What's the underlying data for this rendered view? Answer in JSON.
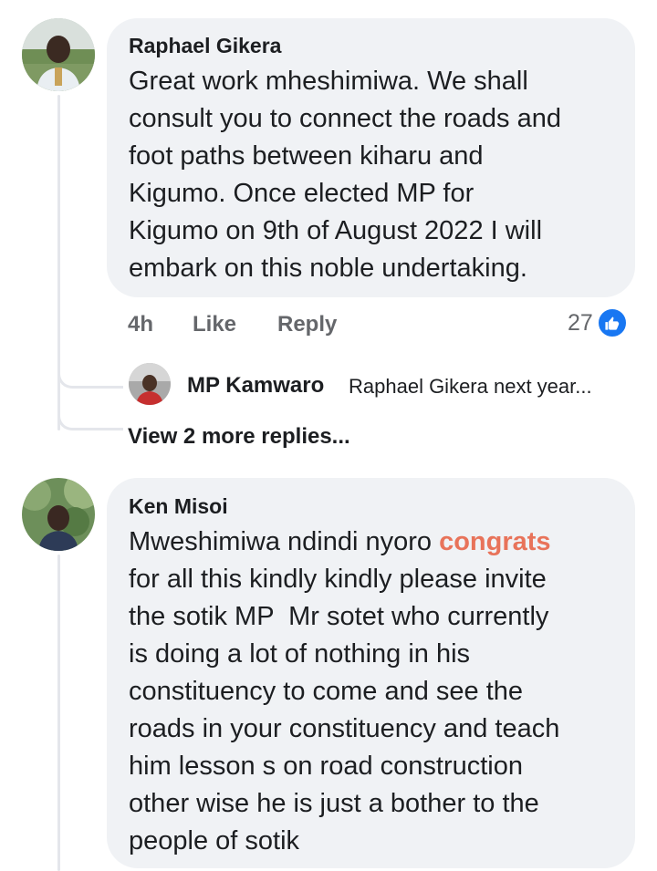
{
  "comments": [
    {
      "author": "Raphael Gikera",
      "lines": [
        "Great work mheshimiwa. We shall",
        "consult you to connect the roads and",
        "foot paths between kiharu and",
        "Kigumo. Once elected MP for",
        "Kigumo on 9th of August 2022 I will",
        "embark on this noble undertaking."
      ],
      "time": "4h",
      "like_label": "Like",
      "reply_label": "Reply",
      "reaction_count": "27",
      "reaction_icon": "like-icon",
      "reply_preview": {
        "author": "MP Kamwaro",
        "text": "Raphael Gikera next year..."
      },
      "view_more": "View 2 more replies..."
    },
    {
      "author": "Ken Misoi",
      "lines_before": "Mweshimiwa ndindi nyoro ",
      "highlight": "congrats",
      "lines": [
        "for all this kindly kindly please invite",
        "the sotik MP  Mr sotet who currently",
        "is doing a lot of nothing in his",
        "constituency to come and see the",
        "roads in your constituency and teach",
        "him lesson s on road construction",
        "other wise he is just a bother to the",
        "people of sotik"
      ]
    }
  ],
  "colors": {
    "bubble": "#f0f2f5",
    "highlight": "#e8735a",
    "like_blue": "#1877f2",
    "muted": "#65676b"
  }
}
